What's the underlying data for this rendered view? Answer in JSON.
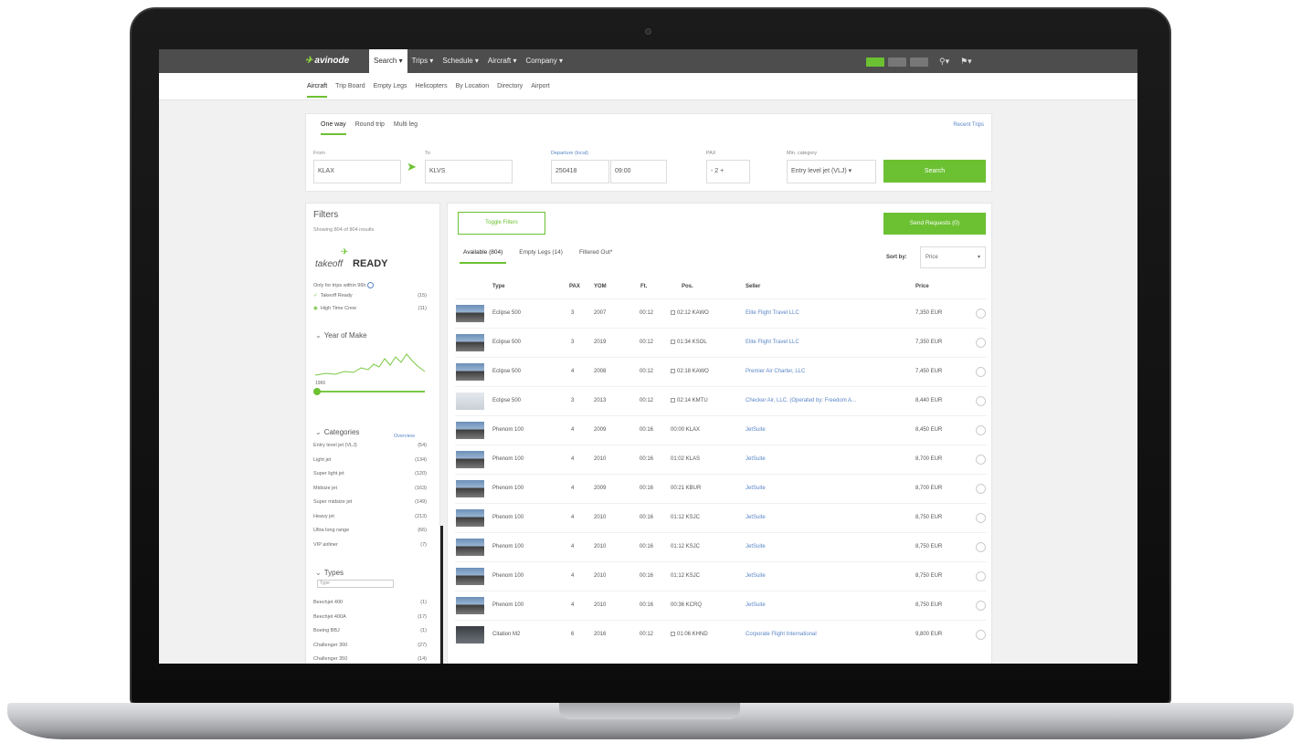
{
  "app": {
    "logo": "avinode",
    "nav": [
      {
        "label": "Search ▾",
        "active": true
      },
      {
        "label": "Trips ▾",
        "active": false
      },
      {
        "label": "Schedule ▾",
        "active": false
      },
      {
        "label": "Aircraft ▾",
        "active": false
      },
      {
        "label": "Company ▾",
        "active": false
      }
    ],
    "subnav": [
      "Aircraft",
      "Trip Board",
      "Empty Legs",
      "Helicopters",
      "By Location",
      "Directory",
      "Airport"
    ]
  },
  "search": {
    "trip_types": [
      "One way",
      "Round trip",
      "Multi leg"
    ],
    "recent_trips": "Recent Trips",
    "from_label": "From",
    "from_value": "KLAX",
    "to_label": "To",
    "to_value": "KLVS",
    "departure_label": "Departure (local)",
    "date_value": "250418",
    "time_value": "09:00",
    "pax_label": "PAX",
    "pax_value": "- 2 +",
    "category_label": "Min. category",
    "category_value": "Entry level jet (VLJ) ▾",
    "search_button": "Search"
  },
  "filters": {
    "title": "Filters",
    "showing": "Showing 804 of 804 results",
    "takeoff_logo_a": "takeoff",
    "takeoff_logo_b": "READY",
    "only_trips": "Only for trips within 96h",
    "takeoff_ready": "Takeoff Ready",
    "takeoff_ready_count": "(15)",
    "high_time_crew": "High Time Crew",
    "high_time_crew_count": "(11)",
    "year_of_make": "Year of Make",
    "year_min": "1966",
    "categories_title": "Categories",
    "overview": "Overview",
    "categories": [
      {
        "name": "Entry level jet (VLJ)",
        "count": "(54)"
      },
      {
        "name": "Light jet",
        "count": "(134)"
      },
      {
        "name": "Super light jet",
        "count": "(120)"
      },
      {
        "name": "Midsize jet",
        "count": "(163)"
      },
      {
        "name": "Super midsize jet",
        "count": "(149)"
      },
      {
        "name": "Heavy jet",
        "count": "(213)"
      },
      {
        "name": "Ultra long range",
        "count": "(66)"
      },
      {
        "name": "VIP airliner",
        "count": "(7)"
      }
    ],
    "types_title": "Types",
    "types_placeholder": "Type",
    "types": [
      {
        "name": "Beechjet 400",
        "count": "(1)"
      },
      {
        "name": "Beechjet 400A",
        "count": "(17)"
      },
      {
        "name": "Boeing BBJ",
        "count": "(1)"
      },
      {
        "name": "Challenger 300",
        "count": "(27)"
      },
      {
        "name": "Challenger 350",
        "count": "(14)"
      }
    ]
  },
  "results": {
    "toggle_filters": "Toggle Filters",
    "send_requests": "Send Requests (0)",
    "tabs": [
      "Available (804)",
      "Empty Legs (14)",
      "Filtered Out*"
    ],
    "sort_by_label": "Sort by:",
    "sort_value": "Price",
    "columns": [
      "Type",
      "PAX",
      "YOM",
      "Ft.",
      "Pos.",
      "Seller",
      "Price"
    ],
    "rows": [
      {
        "type": "Eclipse 500",
        "pax": "3",
        "yom": "2007",
        "ft": "00:12",
        "pos": "02:12 KAWO",
        "seller": "Elite Flight Travel LLC",
        "price": "7,350 EUR",
        "thumb": "photo",
        "pos_icon": true
      },
      {
        "type": "Eclipse 500",
        "pax": "3",
        "yom": "2019",
        "ft": "00:12",
        "pos": "01:34 KSOL",
        "seller": "Elite Flight Travel LLC",
        "price": "7,350 EUR",
        "thumb": "photo",
        "pos_icon": true
      },
      {
        "type": "Eclipse 500",
        "pax": "4",
        "yom": "2008",
        "ft": "00:12",
        "pos": "02:18 KAWO",
        "seller": "Premier Air Charter, LLC",
        "price": "7,450 EUR",
        "thumb": "photo",
        "pos_icon": true
      },
      {
        "type": "Eclipse 500",
        "pax": "3",
        "yom": "2013",
        "ft": "00:12",
        "pos": "02:14 KMTU",
        "seller": "Checker Air, LLC. (Operated by: Freedom A...",
        "price": "8,440 EUR",
        "thumb": "light",
        "pos_icon": true
      },
      {
        "type": "Phenom 100",
        "pax": "4",
        "yom": "2009",
        "ft": "00:16",
        "pos": "00:00 KLAX",
        "seller": "JetSuite",
        "price": "8,450 EUR",
        "thumb": "photo",
        "pos_icon": false
      },
      {
        "type": "Phenom 100",
        "pax": "4",
        "yom": "2010",
        "ft": "00:16",
        "pos": "01:02 KLAS",
        "seller": "JetSuite",
        "price": "8,700 EUR",
        "thumb": "photo",
        "pos_icon": false
      },
      {
        "type": "Phenom 100",
        "pax": "4",
        "yom": "2009",
        "ft": "00:16",
        "pos": "00:21 KBUR",
        "seller": "JetSuite",
        "price": "8,700 EUR",
        "thumb": "photo",
        "pos_icon": false
      },
      {
        "type": "Phenom 100",
        "pax": "4",
        "yom": "2010",
        "ft": "00:16",
        "pos": "01:12 KSJC",
        "seller": "JetSuite",
        "price": "8,750 EUR",
        "thumb": "photo",
        "pos_icon": false
      },
      {
        "type": "Phenom 100",
        "pax": "4",
        "yom": "2010",
        "ft": "00:16",
        "pos": "01:12 KSJC",
        "seller": "JetSuite",
        "price": "8,750 EUR",
        "thumb": "photo",
        "pos_icon": false
      },
      {
        "type": "Phenom 100",
        "pax": "4",
        "yom": "2010",
        "ft": "00:16",
        "pos": "01:12 KSJC",
        "seller": "JetSuite",
        "price": "8,750 EUR",
        "thumb": "photo",
        "pos_icon": false
      },
      {
        "type": "Phenom 100",
        "pax": "4",
        "yom": "2010",
        "ft": "00:16",
        "pos": "00:36 KCRQ",
        "seller": "JetSuite",
        "price": "8,750 EUR",
        "thumb": "photo",
        "pos_icon": false
      },
      {
        "type": "Citation M2",
        "pax": "6",
        "yom": "2016",
        "ft": "00:12",
        "pos": "01:06 KHND",
        "seller": "Corporate Flight International",
        "price": "9,800 EUR",
        "thumb": "dark",
        "pos_icon": true
      }
    ]
  }
}
